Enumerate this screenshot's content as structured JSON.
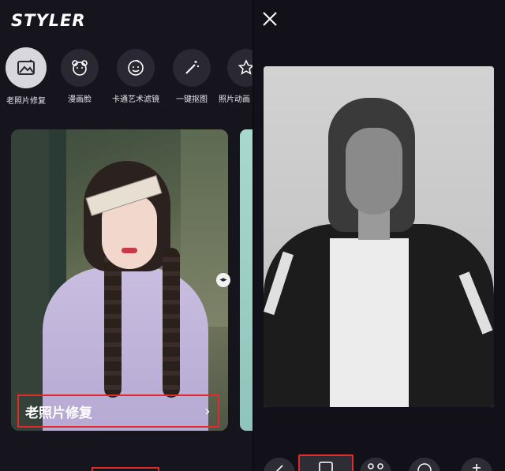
{
  "left": {
    "logo": "STYLER",
    "tools": [
      {
        "label": "老照片修复",
        "icon": "photo-restore-icon",
        "active": true
      },
      {
        "label": "漫画脸",
        "icon": "bear-face-icon"
      },
      {
        "label": "卡通艺术滤镜",
        "icon": "cartoon-face-icon"
      },
      {
        "label": "一键抠图",
        "icon": "magic-wand-icon"
      },
      {
        "label": "照片动画",
        "icon": "star-icon"
      }
    ],
    "card": {
      "caption": "老照片修复",
      "chevron": "›"
    },
    "slider_handle": "◂▸"
  },
  "right": {
    "close": "✕",
    "bottom_tools": [
      {
        "icon": "edit-icon"
      },
      {
        "icon": "photo-restore-icon",
        "selected": true
      },
      {
        "icon": "bear-face-icon"
      },
      {
        "icon": "cartoon-face-icon"
      },
      {
        "icon": "sparkle-icon"
      }
    ]
  },
  "colors": {
    "background": "#15141d",
    "highlight_red": "#e12b2b",
    "tool_circle": "#2a2933"
  }
}
